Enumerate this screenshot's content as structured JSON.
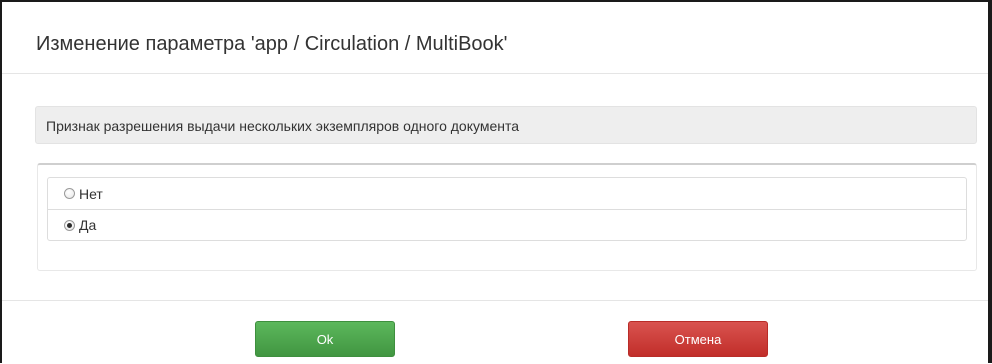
{
  "dialog": {
    "title": "Изменение параметра 'app / Circulation / MultiBook'",
    "description": "Признак разрешения выдачи нескольких экземпляров одного документа",
    "options": [
      {
        "label": "Нет",
        "checked": false
      },
      {
        "label": "Да",
        "checked": true
      }
    ],
    "buttons": {
      "ok_label": "Ok",
      "cancel_label": "Отмена"
    }
  },
  "colors": {
    "ok_button": "#5cb85c",
    "cancel_button": "#d9534f",
    "description_background": "#eeeeee"
  },
  "icons": {
    "option_control": "radio-button-icon"
  }
}
